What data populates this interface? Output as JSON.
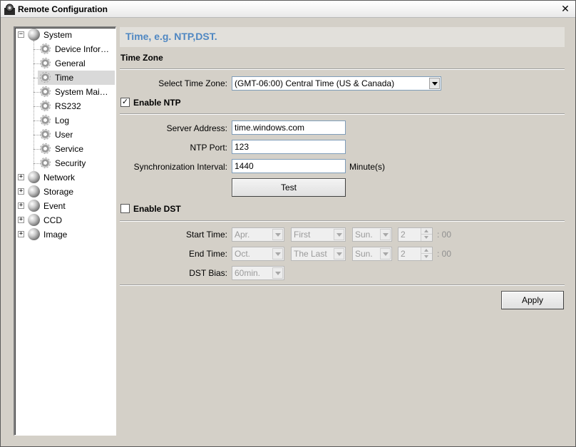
{
  "window": {
    "title": "Remote Configuration",
    "close_glyph": "✕"
  },
  "tree": {
    "expand_glyph": "+",
    "collapse_glyph": "−",
    "system": {
      "label": "System",
      "children": [
        "Device Infor…",
        "General",
        "Time",
        "System Mai…",
        "RS232",
        "Log",
        "User",
        "Service",
        "Security"
      ]
    },
    "others": [
      "Network",
      "Storage",
      "Event",
      "CCD",
      "Image"
    ],
    "selected": "Time"
  },
  "panel": {
    "header": "Time, e.g. NTP,DST.",
    "time_zone_section": "Time Zone",
    "select_time_zone_label": "Select Time Zone:",
    "time_zone_value": "(GMT-06:00) Central Time (US & Canada)",
    "enable_ntp": {
      "label": "Enable NTP",
      "checked": true,
      "check_glyph": "✓"
    },
    "server_address_label": "Server Address:",
    "server_address_value": "time.windows.com",
    "ntp_port_label": "NTP Port:",
    "ntp_port_value": "123",
    "sync_interval_label": "Synchronization Interval:",
    "sync_interval_value": "1440",
    "sync_interval_unit": "Minute(s)",
    "test_button": "Test",
    "enable_dst": {
      "label": "Enable DST",
      "checked": false
    },
    "start_time": {
      "label": "Start Time:",
      "month": "Apr.",
      "week": "First",
      "day": "Sun.",
      "hour": "2",
      "suffix": ": 00"
    },
    "end_time": {
      "label": "End Time:",
      "month": "Oct.",
      "week": "The Last",
      "day": "Sun.",
      "hour": "2",
      "suffix": ": 00"
    },
    "dst_bias": {
      "label": "DST Bias:",
      "value": "60min."
    },
    "apply_button": "Apply"
  },
  "colors": {
    "header_text": "#4f87c2",
    "window_bg": "#d4d0c8",
    "header_bg": "#e2e0db"
  }
}
